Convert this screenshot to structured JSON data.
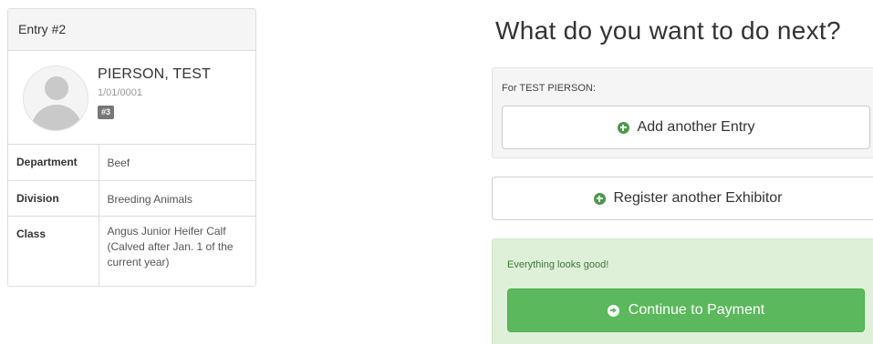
{
  "entry": {
    "header": "Entry #2",
    "person": {
      "name": "PIERSON, TEST",
      "date": "1/01/0001",
      "badge": "#3"
    },
    "details": [
      {
        "label": "Department",
        "value": "Beef"
      },
      {
        "label": "Division",
        "value": "Breeding Animals"
      },
      {
        "label": "Class",
        "value": "Angus Junior Heifer Calf (Calved after Jan. 1 of the current year)"
      }
    ]
  },
  "next": {
    "title": "What do you want to do next?",
    "for_label": "For TEST PIERSON:",
    "add_entry_label": "Add another Entry",
    "register_label": "Register another Exhibitor",
    "success_text": "Everything looks good!",
    "continue_label": "Continue to Payment"
  },
  "colors": {
    "success_bg": "#dff0d8",
    "success_button": "#5cb85c",
    "plus_icon": "#4a9a4a",
    "badge": "#777777"
  },
  "icons": {
    "avatar": "user-avatar-icon",
    "add": "plus-circle-icon",
    "continue": "arrow-circle-right-icon"
  }
}
